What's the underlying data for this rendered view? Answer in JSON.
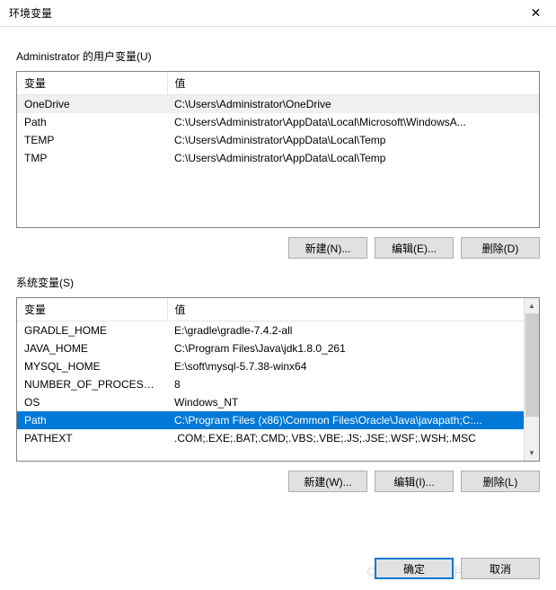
{
  "window": {
    "title": "环境变量"
  },
  "userSection": {
    "label": "Administrator 的用户变量(U)",
    "headers": {
      "var": "变量",
      "val": "值"
    },
    "rows": [
      {
        "var": "OneDrive",
        "val": "C:\\Users\\Administrator\\OneDrive",
        "highlight": true
      },
      {
        "var": "Path",
        "val": "C:\\Users\\Administrator\\AppData\\Local\\Microsoft\\WindowsA..."
      },
      {
        "var": "TEMP",
        "val": "C:\\Users\\Administrator\\AppData\\Local\\Temp"
      },
      {
        "var": "TMP",
        "val": "C:\\Users\\Administrator\\AppData\\Local\\Temp"
      }
    ],
    "buttons": {
      "new": "新建(N)...",
      "edit": "编辑(E)...",
      "del": "删除(D)"
    }
  },
  "sysSection": {
    "label": "系统变量(S)",
    "headers": {
      "var": "变量",
      "val": "值"
    },
    "rows": [
      {
        "var": "GRADLE_HOME",
        "val": "E:\\gradle\\gradle-7.4.2-all"
      },
      {
        "var": "JAVA_HOME",
        "val": "C:\\Program Files\\Java\\jdk1.8.0_261"
      },
      {
        "var": "MYSQL_HOME",
        "val": "E:\\soft\\mysql-5.7.38-winx64"
      },
      {
        "var": "NUMBER_OF_PROCESSORS",
        "val": "8"
      },
      {
        "var": "OS",
        "val": "Windows_NT"
      },
      {
        "var": "Path",
        "val": "C:\\Program Files (x86)\\Common Files\\Oracle\\Java\\javapath;C:...",
        "selected": true
      },
      {
        "var": "PATHEXT",
        "val": ".COM;.EXE;.BAT;.CMD;.VBS;.VBE;.JS;.JSE;.WSF;.WSH;.MSC"
      }
    ],
    "buttons": {
      "new": "新建(W)...",
      "edit": "编辑(I)...",
      "del": "删除(L)"
    }
  },
  "footer": {
    "ok": "确定",
    "cancel": "取消"
  },
  "watermark": "CSDN @秋之千手"
}
